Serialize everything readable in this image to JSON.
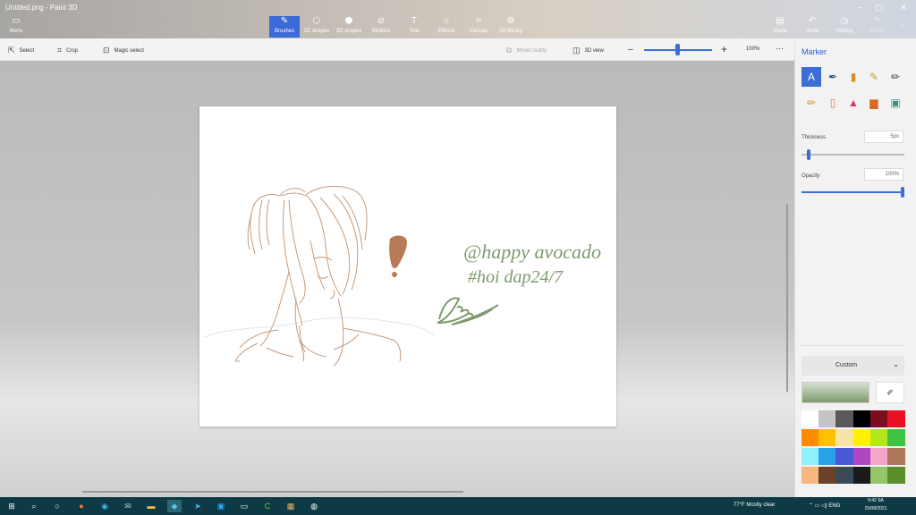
{
  "window": {
    "title": "Untitled.png - Paint 3D"
  },
  "ribbon": {
    "menu": "Menu",
    "tools": [
      "Brushes",
      "2D shapes",
      "3D shapes",
      "Stickers",
      "Text",
      "Effects",
      "Canvas",
      "3D library"
    ],
    "paste": "Paste",
    "undo": "Undo",
    "history": "History",
    "redo": "Redo"
  },
  "toolbar": {
    "select": "Select",
    "crop": "Crop",
    "magic_select": "Magic select",
    "mixed_reality": "Mixed reality",
    "view_3d": "3D view",
    "zoom": "100%",
    "zoom_level": 0.5
  },
  "canvas_art": {
    "handle": "@happy avocado",
    "tag": "#hoi dap24/7",
    "exclaim": "!",
    "signature": "Lâm"
  },
  "panel": {
    "title": "Marker",
    "thickness_label": "Thickness",
    "thickness_value": "5px",
    "thickness_level": 0.05,
    "opacity_label": "Opacity",
    "opacity_value": "100%",
    "opacity_level": 1.0,
    "color_mode": "Custom"
  },
  "colors": {
    "accent": "#3b6fd6",
    "sketch": "#c49b7c",
    "text_green": "#7c9a6d",
    "exclaim": "#b87a55",
    "palette": [
      "#ffffff",
      "#c4c4c4",
      "#595959",
      "#000000",
      "#7a0e1f",
      "#e81123",
      "#ff8c00",
      "#ffc000",
      "#f6e4a6",
      "#fff100",
      "#b4e61e",
      "#3ec343",
      "#8ff0ff",
      "#2aa1e8",
      "#4a58d4",
      "#b146c2",
      "#f4a6c8",
      "#b0785a",
      "#f6b67f",
      "#6b4128",
      "#3a4a56",
      "#1a1a1a",
      "#95c46a",
      "#5a8f2a"
    ]
  },
  "taskbar": {
    "weather": "77°F  Mostly clear",
    "lang": "ENG",
    "time": "9:42 SA",
    "date": "15/08/2021"
  }
}
